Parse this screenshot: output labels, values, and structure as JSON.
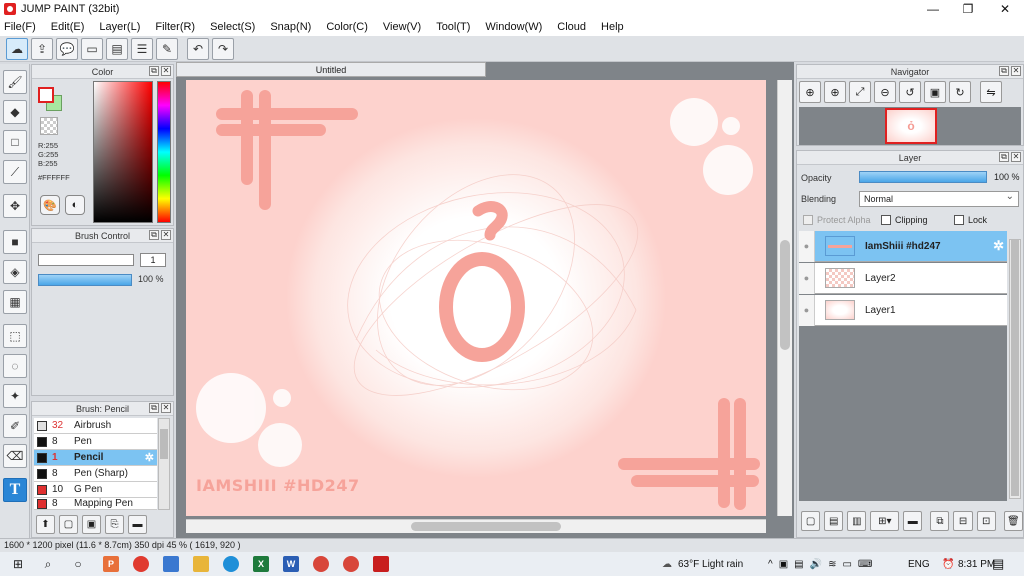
{
  "window": {
    "title": "JUMP PAINT (32bit)",
    "min": "—",
    "restore": "❐",
    "close": "✕"
  },
  "menu": [
    "File(F)",
    "Edit(E)",
    "Layer(L)",
    "Filter(R)",
    "Select(S)",
    "Snap(N)",
    "Color(C)",
    "View(V)",
    "Tool(T)",
    "Window(W)",
    "Cloud",
    "Help"
  ],
  "color_panel": {
    "title": "Color",
    "r": "R:255",
    "g": "G:255",
    "b": "B:255",
    "hex": "#FFFFFF"
  },
  "brush_control": {
    "title": "Brush Control",
    "size": "1",
    "opacity": "100 %"
  },
  "brush_list": {
    "title": "Brush: Pencil",
    "items": [
      {
        "size": "32",
        "name": "Airbrush",
        "color": "#e0e0e0"
      },
      {
        "size": "8",
        "name": "Pen",
        "color": "#111111"
      },
      {
        "size": "1",
        "name": "Pencil",
        "color": "#111111"
      },
      {
        "size": "8",
        "name": "Pen (Sharp)",
        "color": "#111111"
      },
      {
        "size": "10",
        "name": "G Pen",
        "color": "#e03030"
      },
      {
        "size": "8",
        "name": "Mapping Pen",
        "color": "#e03030"
      }
    ]
  },
  "document": {
    "tab": "Untitled",
    "artwork_text": "IAMSHIII #HD247",
    "glyph": "ỏ"
  },
  "navigator": {
    "title": "Navigator"
  },
  "layer_panel": {
    "title": "Layer",
    "opacity_label": "Opacity",
    "opacity_value": "100 %",
    "blending_label": "Blending",
    "blending_value": "Normal",
    "protect_alpha": "Protect Alpha",
    "clipping": "Clipping",
    "lock": "Lock",
    "layers": [
      {
        "name": "IamShiii #hd247",
        "selected": true
      },
      {
        "name": "Layer2",
        "selected": false
      },
      {
        "name": "Layer1",
        "selected": false
      }
    ]
  },
  "status": {
    "text": "1600 * 1200 pixel   (11.6 * 8.7cm)   350 dpi   45 %   ( 1619, 920 )"
  },
  "taskbar": {
    "weather": "63°F  Light rain",
    "lang": "ENG",
    "time": "8:31 PM"
  },
  "colors": {
    "accent": "#4aa6e8",
    "art_pink": "#f6a39a",
    "selection": "#7cc3f2"
  }
}
